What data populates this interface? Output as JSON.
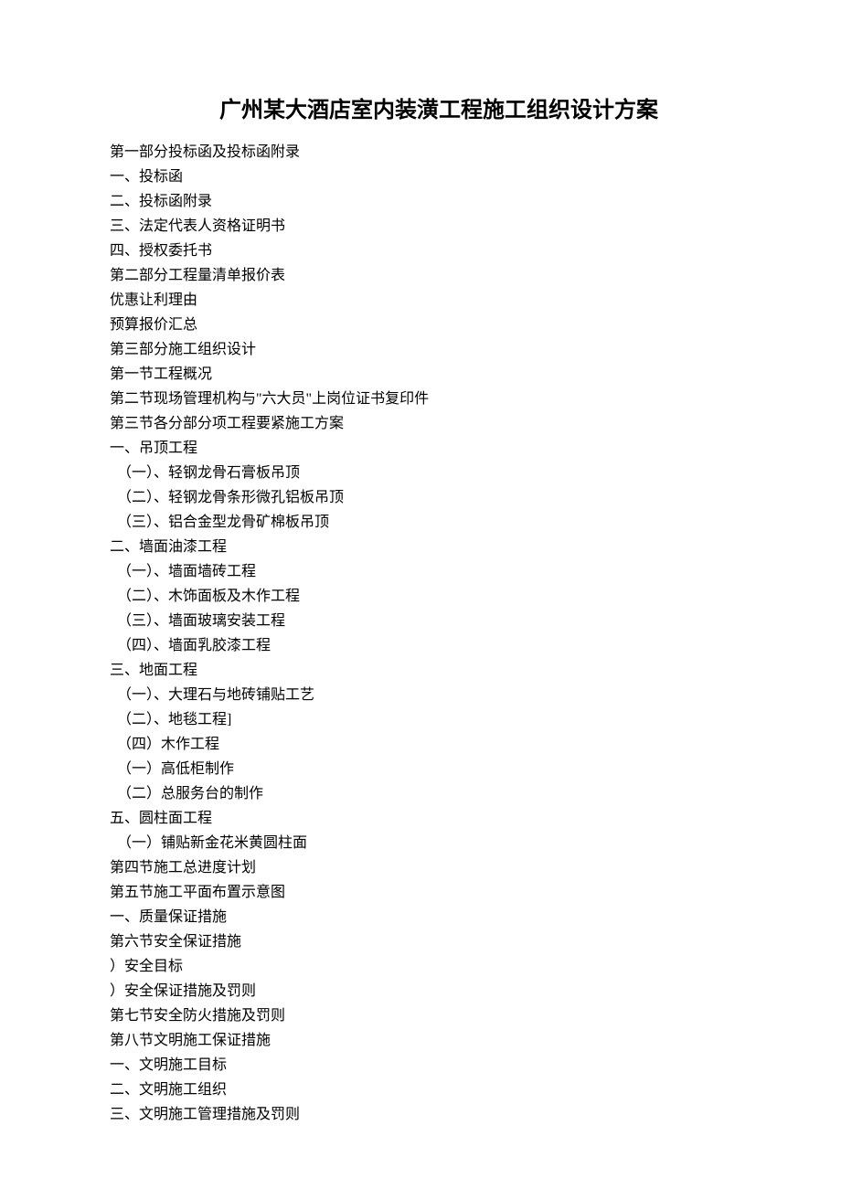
{
  "title": "广州某大酒店室内装潢工程施工组织设计方案",
  "lines": [
    "第一部分投标函及投标函附录",
    "一、投标函",
    "二、投标函附录",
    "三、法定代表人资格证明书",
    "四、授权委托书",
    "第二部分工程量清单报价表",
    "优惠让利理由",
    "预算报价汇总",
    "第三部分施工组织设计",
    "第一节工程概况",
    "第二节现场管理机构与\"六大员\"上岗位证书复印件",
    "第三节各分部分项工程要紧施工方案",
    "一、吊顶工程",
    "（一）、轻钢龙骨石膏板吊顶",
    "（二）、轻钢龙骨条形微孔铝板吊顶",
    "（三）、铝合金型龙骨矿棉板吊顶",
    "二、墙面油漆工程",
    "（一）、墙面墙砖工程",
    "（二）、木饰面板及木作工程",
    "（三）、墙面玻璃安装工程",
    "（四）、墙面乳胶漆工程",
    "三、地面工程",
    "（一）、大理石与地砖铺贴工艺",
    "（二）、地毯工程]",
    "（四）木作工程",
    "（一）高低柜制作",
    "（二）总服务台的制作",
    "五、圆柱面工程",
    "（一）铺贴新金花米黄圆柱面",
    "第四节施工总进度计划",
    "第五节施工平面布置示意图",
    "一、质量保证措施",
    "第六节安全保证措施",
    "）安全目标",
    "）安全保证措施及罚则",
    "第七节安全防火措施及罚则",
    "第八节文明施工保证措施",
    "一、文明施工目标",
    "二、文明施工组织",
    "三、文明施工管理措施及罚则"
  ]
}
